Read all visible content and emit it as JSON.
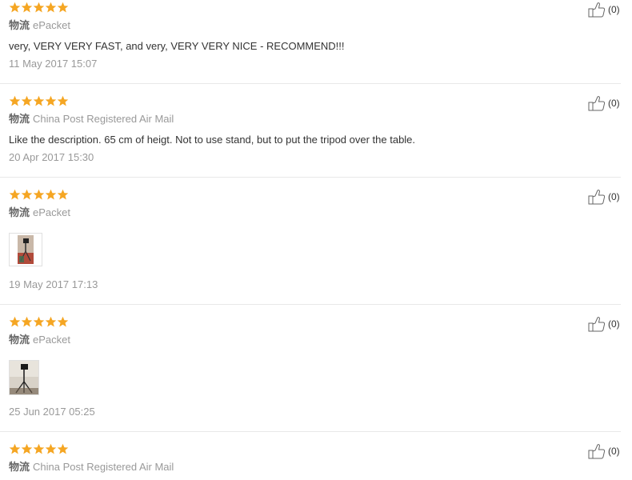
{
  "colors": {
    "star": "#f5a623",
    "muted": "#999999",
    "text": "#333333"
  },
  "reviews": [
    {
      "rating": 5,
      "shipping_label": "物流",
      "shipping": "ePacket",
      "text": "very, VERY VERY FAST, and very, VERY VERY NICE - RECOMMEND!!!",
      "date": "11 May 2017 15:07",
      "helpful": "(0)"
    },
    {
      "rating": 5,
      "shipping_label": "物流",
      "shipping": "China Post Registered Air Mail",
      "text": "Like the description. 65 cm of heigt. Not to use stand, but to put the tripod over the table.",
      "date": "20 Apr 2017 15:30",
      "helpful": "(0)"
    },
    {
      "rating": 5,
      "shipping_label": "物流",
      "shipping": "ePacket",
      "text": "",
      "photo": "tripod-photo",
      "date": "19 May 2017 17:13",
      "helpful": "(0)"
    },
    {
      "rating": 5,
      "shipping_label": "物流",
      "shipping": "ePacket",
      "text": "",
      "photo": "tripod-photo",
      "date": "25 Jun 2017 05:25",
      "helpful": "(0)"
    },
    {
      "rating": 5,
      "shipping_label": "物流",
      "shipping": "China Post Registered Air Mail",
      "text": "",
      "date": "",
      "helpful": "(0)"
    }
  ]
}
